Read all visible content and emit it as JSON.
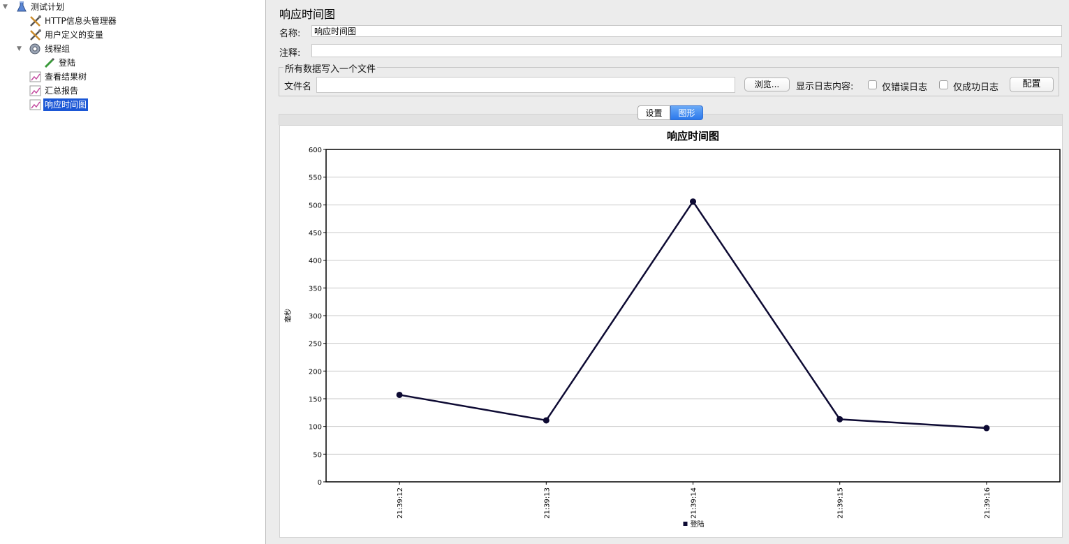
{
  "tree": {
    "items": [
      {
        "label": "测试计划",
        "icon": "flask-icon",
        "expanded": true
      },
      {
        "label": "HTTP信息头管理器",
        "icon": "tools-icon"
      },
      {
        "label": "用户定义的变量",
        "icon": "tools-icon"
      },
      {
        "label": "线程组",
        "icon": "gear-icon",
        "expanded": true
      },
      {
        "label": "登陆",
        "icon": "pipette-icon"
      },
      {
        "label": "查看结果树",
        "icon": "graph-icon"
      },
      {
        "label": "汇总报告",
        "icon": "graph-icon"
      },
      {
        "label": "响应时间图",
        "icon": "graph-icon",
        "selected": true
      }
    ]
  },
  "panel": {
    "title": "响应时间图",
    "name_label": "名称:",
    "name_value": "响应时间图",
    "comment_label": "注释:",
    "comment_value": "",
    "file_group": {
      "legend": "所有数据写入一个文件",
      "filename_label": "文件名",
      "filename_value": "",
      "browse_label": "浏览...",
      "log_label": "显示日志内容:",
      "errors_only_label": "仅错误日志",
      "success_only_label": "仅成功日志",
      "configure_label": "配置"
    },
    "tabs": [
      {
        "label": "设置",
        "active": false
      },
      {
        "label": "图形",
        "active": true
      }
    ]
  },
  "colors": {
    "selection": "#1b57d6",
    "series": "#0d0a33",
    "tab_active": "#2c79ec"
  },
  "chart_data": {
    "type": "line",
    "title": "响应时间图",
    "ylabel": "毫秒",
    "ylim": [
      0,
      600
    ],
    "yticks": [
      0,
      50,
      100,
      150,
      200,
      250,
      300,
      350,
      400,
      450,
      500,
      550,
      600
    ],
    "x": [
      "21:39:12",
      "21:39:13",
      "21:39:14",
      "21:39:15",
      "21:39:16"
    ],
    "series": [
      {
        "name": "登陆",
        "values": [
          157,
          111,
          506,
          113,
          97
        ]
      }
    ],
    "grid": true,
    "legend": "bottom"
  }
}
